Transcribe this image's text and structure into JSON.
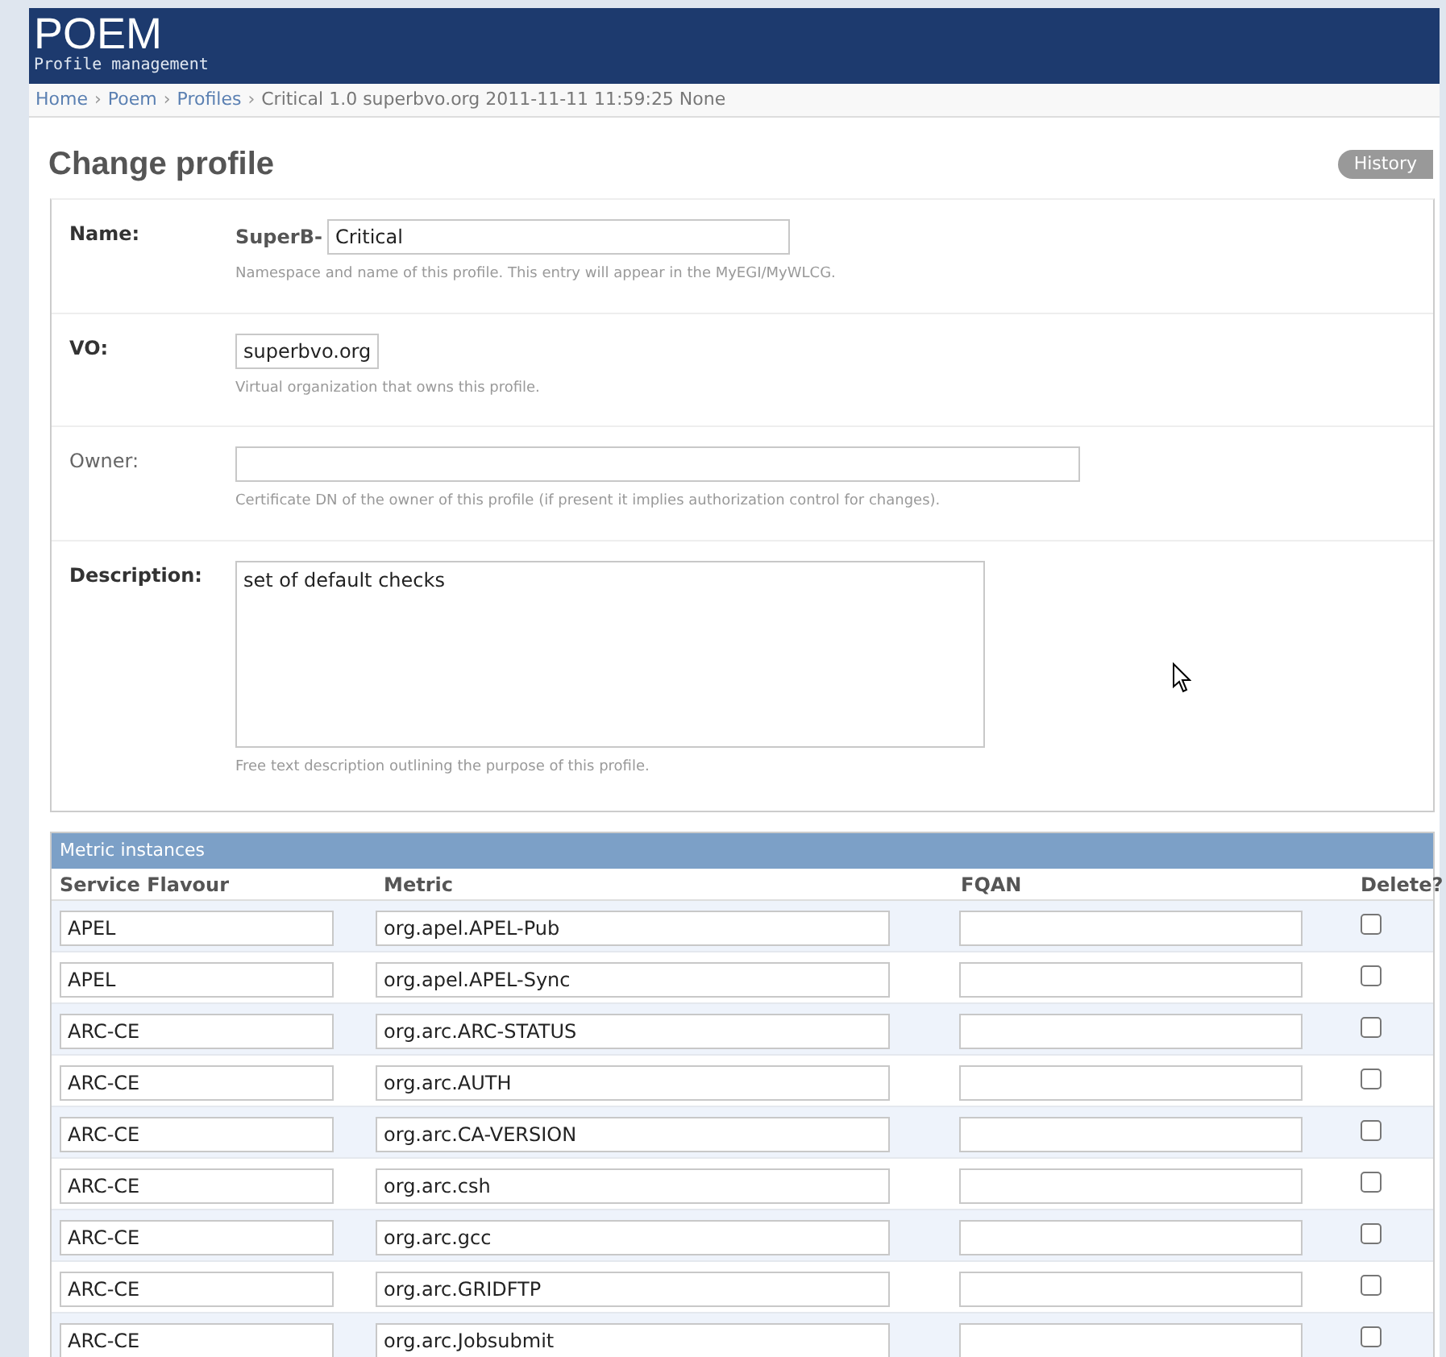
{
  "header": {
    "title": "POEM",
    "subtitle": "Profile management"
  },
  "breadcrumb": {
    "separator": "›",
    "links": [
      "Home",
      "Poem",
      "Profiles"
    ],
    "current": "Critical 1.0 superbvo.org 2011-11-11 11:59:25 None"
  },
  "page_title": "Change profile",
  "history_button": "History",
  "form": [
    {
      "kind": "name",
      "label": "Name:",
      "required": true,
      "prefix": "SuperB-",
      "value": "Critical",
      "help": "Namespace and name of this profile. This entry will appear in the MyEGI/MyWLCG."
    },
    {
      "kind": "short",
      "label": "VO:",
      "required": true,
      "value": "superbvo.org",
      "help": "Virtual organization that owns this profile."
    },
    {
      "kind": "long",
      "label": "Owner:",
      "required": false,
      "help": "Certificate DN of the owner of this profile (if present it implies authorization control for changes)."
    },
    {
      "kind": "textarea",
      "label": "Description:",
      "required": true,
      "value": "set of default checks",
      "help": "Free text description outlining the purpose of this profile."
    }
  ],
  "metric_instances": {
    "title": "Metric instances",
    "columns": [
      "Service Flavour",
      "Metric",
      "FQAN",
      "Delete?"
    ],
    "rows": [
      {
        "service_flavour": "APEL",
        "metric": "org.apel.APEL-Pub",
        "delete": false
      },
      {
        "service_flavour": "APEL",
        "metric": "org.apel.APEL-Sync",
        "delete": false
      },
      {
        "service_flavour": "ARC-CE",
        "metric": "org.arc.ARC-STATUS",
        "delete": false
      },
      {
        "service_flavour": "ARC-CE",
        "metric": "org.arc.AUTH",
        "delete": false
      },
      {
        "service_flavour": "ARC-CE",
        "metric": "org.arc.CA-VERSION",
        "delete": false
      },
      {
        "service_flavour": "ARC-CE",
        "metric": "org.arc.csh",
        "delete": false
      },
      {
        "service_flavour": "ARC-CE",
        "metric": "org.arc.gcc",
        "delete": false
      },
      {
        "service_flavour": "ARC-CE",
        "metric": "org.arc.GRIDFTP",
        "delete": false
      },
      {
        "service_flavour": "ARC-CE",
        "metric": "org.arc.Jobsubmit",
        "delete": false
      }
    ]
  }
}
